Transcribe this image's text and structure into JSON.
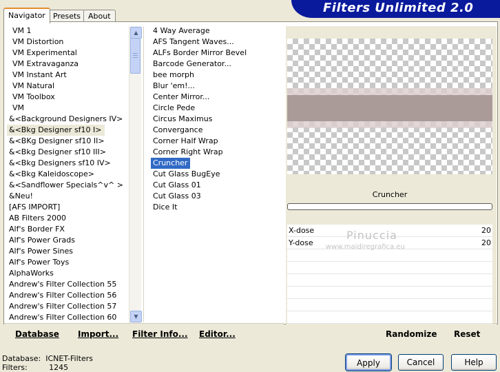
{
  "app": {
    "title": "Filters Unlimited 2.0"
  },
  "tabs": [
    "Navigator",
    "Presets",
    "About"
  ],
  "categories": [
    "VM 1",
    "VM Distortion",
    "VM Experimental",
    "VM Extravaganza",
    "VM Instant Art",
    "VM Natural",
    "VM Toolbox",
    "VM",
    "&<Background Designers IV>",
    "&<Bkg Designer sf10 I>",
    "&<BKg Designer sf10 II>",
    "&<Bkg Designer sf10 III>",
    "&<Bkg Designers sf10 IV>",
    "&<Bkg Kaleidoscope>",
    "&<Sandflower Specials^v^ >",
    "&Neu!",
    "[AFS IMPORT]",
    "AB Filters 2000",
    "Alf's Border FX",
    "Alf's Power Grads",
    "Alf's Power Sines",
    "Alf's Power Toys",
    "AlphaWorks",
    "Andrew's Filter Collection 55",
    "Andrew's Filter Collection 56",
    "Andrew's Filter Collection 57",
    "Andrew's Filter Collection 60"
  ],
  "selected_category": "&<Bkg Designer sf10 I>",
  "filters": [
    "4 Way Average",
    "AFS Tangent Waves...",
    "ALFs Border Mirror Bevel",
    "Barcode Generator...",
    "bee morph",
    "Blur 'em!...",
    "Center Mirror...",
    "Circle Pede",
    "Circus Maximus",
    "Convergance",
    "Corner Half Wrap",
    "Corner Right Wrap",
    "Cruncher",
    "Cut Glass  BugEye",
    "Cut Glass 01",
    "Cut Glass 03",
    "Dice It"
  ],
  "selected_filter": "Cruncher",
  "preview": {
    "filter_name": "Cruncher",
    "stripe_color": "#aa9a98"
  },
  "params": [
    {
      "label": "X-dose",
      "value": "20"
    },
    {
      "label": "Y-dose",
      "value": "20"
    }
  ],
  "watermark": {
    "name": "Pinuccia",
    "url": "www.maidiregrafica.eu"
  },
  "left_buttons": {
    "database": "Database",
    "import": "Import...",
    "filter_info": "Filter Info...",
    "editor": "Editor..."
  },
  "right_buttons": {
    "randomize": "Randomize",
    "reset": "Reset"
  },
  "footer": {
    "database_label": "Database:",
    "database_value": "ICNET-Filters",
    "filters_label": "Filters:",
    "filters_value": "1245"
  },
  "dialog_buttons": {
    "apply": "Apply",
    "cancel": "Cancel",
    "help": "Help"
  },
  "colors": {
    "banner": "#0a1a9c",
    "selection": "#316ac5",
    "tab_accent": "#e68b2c"
  }
}
